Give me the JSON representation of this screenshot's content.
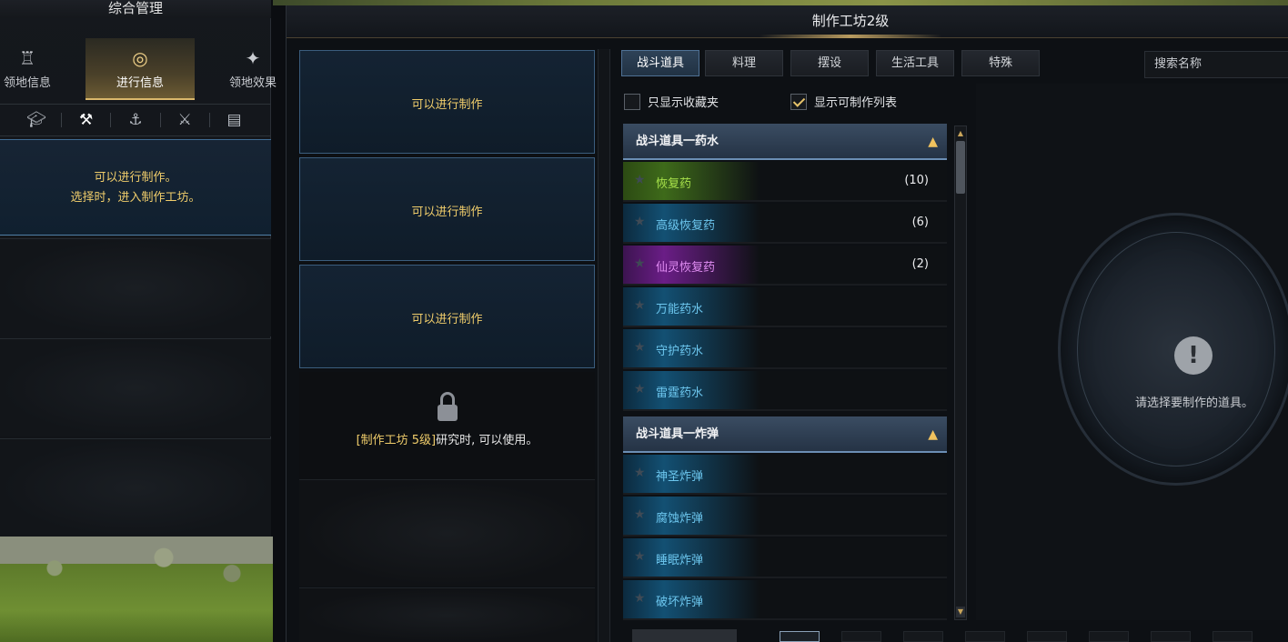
{
  "left": {
    "title": "综合管理",
    "tabs": [
      {
        "label": "领地信息",
        "icon": "castle-icon"
      },
      {
        "label": "进行信息",
        "icon": "compass-icon"
      },
      {
        "label": "领地效果",
        "icon": "sparkle-icon"
      }
    ],
    "icon_bar": [
      "graduation-cap-icon",
      "crossed-tools-icon",
      "anchor-icon",
      "crossed-swords-icon",
      "book-icon"
    ],
    "info_line1": "可以进行制作。",
    "info_line2": "选择时，进入制作工坊。"
  },
  "window": {
    "title": "制作工坊2级"
  },
  "slots": [
    {
      "text": "可以进行制作"
    },
    {
      "text": "可以进行制作"
    },
    {
      "text": "可以进行制作"
    }
  ],
  "locked_slot": {
    "requirement": "[制作工坊 5级]",
    "text": "研究时, 可以使用。"
  },
  "category_tabs": [
    "战斗道具",
    "料理",
    "摆设",
    "生活工具",
    "特殊"
  ],
  "search": {
    "placeholder": "搜索名称"
  },
  "filters": {
    "favorites_only": {
      "label": "只显示收藏夹",
      "checked": false
    },
    "craftable_only": {
      "label": "显示可制作列表",
      "checked": true
    }
  },
  "groups": [
    {
      "title": "战斗道具一药水",
      "items": [
        {
          "name": "恢复药",
          "count": "(10)",
          "grade": "green"
        },
        {
          "name": "高级恢复药",
          "count": "(6)",
          "grade": "blue"
        },
        {
          "name": "仙灵恢复药",
          "count": "(2)",
          "grade": "purple"
        },
        {
          "name": "万能药水",
          "count": "",
          "grade": "blue"
        },
        {
          "name": "守护药水",
          "count": "",
          "grade": "blue"
        },
        {
          "name": "雷霆药水",
          "count": "",
          "grade": "blue"
        }
      ]
    },
    {
      "title": "战斗道具一炸弹",
      "items": [
        {
          "name": "神圣炸弹",
          "count": "",
          "grade": "blue"
        },
        {
          "name": "腐蚀炸弹",
          "count": "",
          "grade": "blue"
        },
        {
          "name": "睡眠炸弹",
          "count": "",
          "grade": "blue"
        },
        {
          "name": "破坏炸弹",
          "count": "",
          "grade": "blue"
        }
      ]
    }
  ],
  "detail": {
    "message": "请选择要制作的道具。"
  },
  "colors": {
    "gold_text": "#f0cd6b",
    "accent_blue": "#4f7195",
    "grade_green": "#a6e04a",
    "grade_blue": "#6cc6ee",
    "grade_purple": "#e08cf2"
  }
}
